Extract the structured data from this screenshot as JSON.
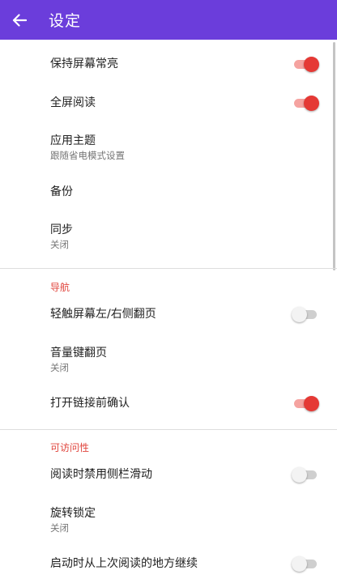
{
  "header": {
    "title": "设定",
    "back_icon": "arrow-left-icon",
    "bg_color": "#6b3ddb"
  },
  "general": {
    "keep_screen_on": {
      "title": "保持屏幕常亮",
      "enabled": true
    },
    "fullscreen_reading": {
      "title": "全屏阅读",
      "enabled": true
    },
    "app_theme": {
      "title": "应用主题",
      "subtitle": "跟随省电模式设置"
    },
    "backup": {
      "title": "备份"
    },
    "sync": {
      "title": "同步",
      "subtitle": "关闭"
    }
  },
  "navigation": {
    "header": "导航",
    "tap_edges": {
      "title": "轻触屏幕左/右侧翻页",
      "enabled": false
    },
    "volume_keys": {
      "title": "音量键翻页",
      "subtitle": "关闭"
    },
    "confirm_links": {
      "title": "打开链接前确认",
      "enabled": true
    }
  },
  "accessibility": {
    "header": "可访问性",
    "disable_sidebar_swipe": {
      "title": "阅读时禁用侧栏滑动",
      "enabled": false
    },
    "rotation_lock": {
      "title": "旋转锁定",
      "subtitle": "关闭"
    },
    "resume_last_position": {
      "title": "启动时从上次阅读的地方继续",
      "enabled": false
    }
  },
  "colors": {
    "accent": "#e53935",
    "section_header": "#e0453d"
  }
}
